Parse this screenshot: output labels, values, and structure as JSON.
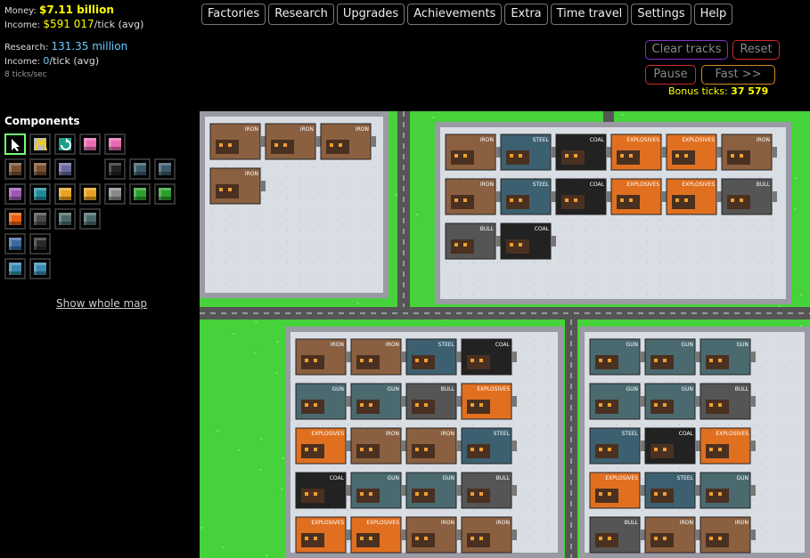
{
  "stats": {
    "money_label": "Money:",
    "money_value": "$7.11 billion",
    "income_label": "Income:",
    "income_value": "$591 017",
    "income_suffix": "/tick (avg)",
    "research_label": "Research:",
    "research_value": "131.35 million",
    "research_income_label": "Income:",
    "research_income_value": "0",
    "research_income_suffix": "/tick (avg)",
    "speed": "8 ticks/sec"
  },
  "menu": [
    "Factories",
    "Research",
    "Upgrades",
    "Achievements",
    "Extra",
    "Time travel",
    "Settings",
    "Help"
  ],
  "controls": {
    "clear_tracks": "Clear tracks",
    "reset": "Reset",
    "pause": "Pause",
    "fast": "Fast >>",
    "bonus_label": "Bonus ticks:",
    "bonus_value": "37 579"
  },
  "components": {
    "title": "Components",
    "show_map": "Show whole map",
    "rows": [
      [
        {
          "icon": "select-arrow-icon",
          "color": "#000000",
          "selected": true
        },
        {
          "icon": "conveyor-icon",
          "color": "#9a9a9a"
        },
        {
          "icon": "rotate-icon",
          "color": "#1e9e8c"
        },
        {
          "icon": "buyer-icon",
          "color": "#e86bb0"
        },
        {
          "icon": "seller-icon",
          "color": "#e86bb0"
        }
      ],
      [
        {
          "icon": "iron-mine-icon",
          "color": "#7a5030"
        },
        {
          "icon": "iron-foundry-icon",
          "color": "#7a5030"
        },
        {
          "icon": "ore-icon",
          "color": "#6a6aa0"
        },
        {
          "icon": "empty",
          "color": ""
        },
        {
          "icon": "coal-mine-icon",
          "color": "#222222"
        },
        {
          "icon": "steel-foundry-icon",
          "color": "#3a5a6a"
        },
        {
          "icon": "steel-icon",
          "color": "#3a5a6a"
        }
      ],
      [
        {
          "icon": "oil-icon",
          "color": "#9a5ab0"
        },
        {
          "icon": "chemical-icon",
          "color": "#1e8a9a"
        },
        {
          "icon": "explosives-icon",
          "color": "#e8a020"
        },
        {
          "icon": "explosives-factory-icon",
          "color": "#e8a020"
        },
        {
          "icon": "quarry-icon",
          "color": "#8a8a8a"
        },
        {
          "icon": "green-factory-icon",
          "color": "#2aa02a"
        },
        {
          "icon": "bullet-icon",
          "color": "#2aa02a"
        }
      ],
      [
        {
          "icon": "gun-factory-icon",
          "color": "#e86010"
        },
        {
          "icon": "engine-icon",
          "color": "#4a4a4a"
        },
        {
          "icon": "gear-icon",
          "color": "#4a6a6a"
        },
        {
          "icon": "gun-icon",
          "color": "#4a6a6a"
        }
      ],
      [
        {
          "icon": "tube-icon",
          "color": "#3a6aa0"
        },
        {
          "icon": "clock-icon",
          "color": "#2a2a2a"
        }
      ],
      [
        {
          "icon": "computer-icon",
          "color": "#3a8ab0"
        },
        {
          "icon": "monitor-icon",
          "color": "#3a8ab0"
        }
      ]
    ]
  },
  "map": {
    "factories": [
      {
        "id": "f1",
        "buildings": [
          {
            "type": "IRON"
          },
          {
            "type": "IRON"
          },
          {
            "type": "IRON"
          },
          {
            "type": "IRON"
          }
        ]
      },
      {
        "id": "f2",
        "buildings": [
          {
            "type": "IRON"
          },
          {
            "type": "STEEL"
          },
          {
            "type": "COAL"
          },
          {
            "type": "EXPLOSIVES"
          },
          {
            "type": "EXPLOSIVES"
          },
          {
            "type": "IRON"
          },
          {
            "type": "IRON"
          },
          {
            "type": "STEEL"
          },
          {
            "type": "COAL"
          },
          {
            "type": "EXPLOSIVES"
          },
          {
            "type": "EXPLOSIVES"
          },
          {
            "type": "BULL"
          },
          {
            "type": "BULL"
          },
          {
            "type": "COAL"
          }
        ]
      },
      {
        "id": "f3",
        "buildings": [
          {
            "type": "IRON"
          },
          {
            "type": "IRON"
          },
          {
            "type": "STEEL"
          },
          {
            "type": "COAL"
          },
          {
            "type": "GUN"
          },
          {
            "type": "GUN"
          },
          {
            "type": "BULL"
          },
          {
            "type": "EXPLOSIVES"
          },
          {
            "type": "EXPLOSIVES"
          },
          {
            "type": "IRON"
          },
          {
            "type": "IRON"
          },
          {
            "type": "STEEL"
          },
          {
            "type": "COAL"
          },
          {
            "type": "GUN"
          },
          {
            "type": "GUN"
          },
          {
            "type": "BULL"
          },
          {
            "type": "EXPLOSIVES"
          },
          {
            "type": "EXPLOSIVES"
          },
          {
            "type": "IRON"
          },
          {
            "type": "IRON"
          },
          {
            "type": "STEEL"
          },
          {
            "type": "COAL"
          }
        ]
      },
      {
        "id": "f4",
        "buildings": [
          {
            "type": "GUN"
          },
          {
            "type": "GUN"
          },
          {
            "type": "GUN"
          },
          {
            "type": "GUN"
          },
          {
            "type": "GUN"
          },
          {
            "type": "BULL"
          },
          {
            "type": "STEEL"
          },
          {
            "type": "COAL"
          },
          {
            "type": "EXPLOSIVES"
          },
          {
            "type": "EXPLOSIVES"
          },
          {
            "type": "STEEL"
          },
          {
            "type": "GUN"
          },
          {
            "type": "BULL"
          },
          {
            "type": "IRON"
          },
          {
            "type": "IRON"
          },
          {
            "type": "EXPLOSIVES"
          },
          {
            "type": "EXPLOSIVES"
          },
          {
            "type": "STEEL"
          },
          {
            "type": "IRON"
          }
        ]
      }
    ]
  }
}
